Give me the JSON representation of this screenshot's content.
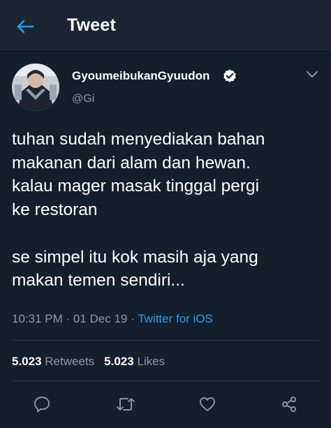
{
  "header": {
    "title": "Tweet",
    "back_icon": "arrow-left-icon"
  },
  "colors": {
    "background": "#151e2b",
    "header_bg": "#1b2430",
    "accent": "#1da1f2",
    "muted": "#8899a6",
    "divider": "#2f3b48"
  },
  "tweet": {
    "author": {
      "name": "GyoumeibukanGyuudon",
      "handle": "@Gi",
      "verified": true
    },
    "text": "tuhan sudah menyediakan bahan\nmakanan dari alam dan hewan.\nkalau mager masak tinggal pergi\nke restoran\n\nse simpel itu kok masih aja yang\nmakan temen sendiri...",
    "time": "10:31 PM",
    "date": "01 Dec 19",
    "source": "Twitter for iOS",
    "retweets": {
      "count": "5.023",
      "label": "Retweets"
    },
    "likes": {
      "count": "5.023",
      "label": "Likes"
    }
  },
  "actions": [
    "reply-icon",
    "retweet-icon",
    "like-icon",
    "share-icon"
  ]
}
